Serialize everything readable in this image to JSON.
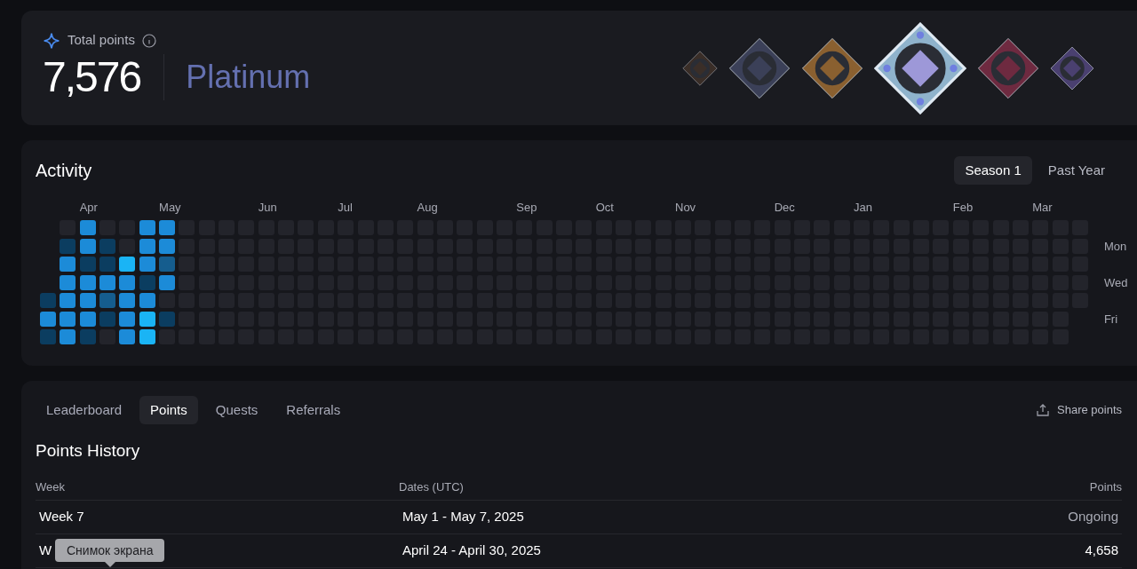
{
  "summary": {
    "label": "Total points",
    "total": "7,576",
    "tier": "Platinum"
  },
  "medals": [
    {
      "color": "#3a2e28",
      "selected": false
    },
    {
      "color": "#3b4058",
      "selected": false
    },
    {
      "color": "#8a6030",
      "selected": false
    },
    {
      "color": "#8fb3cc",
      "selected": true
    },
    {
      "color": "#6e2a40",
      "selected": false
    },
    {
      "color": "#4a4070",
      "selected": false
    }
  ],
  "activity": {
    "title": "Activity",
    "ranges": [
      {
        "label": "Season 1",
        "selected": true
      },
      {
        "label": "Past Year",
        "selected": false
      }
    ],
    "weekdays": [
      {
        "label": "Mon"
      },
      {
        "label": "Wed"
      },
      {
        "label": "Fri"
      }
    ],
    "weeks": [
      {
        "days": [
          {
            "kind": "low"
          },
          {
            "kind": "high"
          },
          {
            "kind": "low"
          }
        ]
      },
      {
        "days": [
          {
            "kind": "empty"
          },
          {
            "kind": "low"
          },
          {
            "kind": "high"
          },
          {
            "kind": "high"
          },
          {
            "kind": "high"
          },
          {
            "kind": "high"
          },
          {
            "kind": "high"
          }
        ]
      },
      {
        "month": "Apr",
        "days": [
          {
            "kind": "high"
          },
          {
            "kind": "high"
          },
          {
            "kind": "low"
          },
          {
            "kind": "high"
          },
          {
            "kind": "high"
          },
          {
            "kind": "high"
          },
          {
            "kind": "low"
          }
        ]
      },
      {
        "days": [
          {
            "kind": "empty"
          },
          {
            "kind": "low"
          },
          {
            "kind": "low"
          },
          {
            "kind": "high"
          },
          {
            "kind": "mid"
          },
          {
            "kind": "low"
          },
          {
            "kind": "empty"
          }
        ]
      },
      {
        "days": [
          {
            "kind": "empty"
          },
          {
            "kind": "empty"
          },
          {
            "kind": "max"
          },
          {
            "kind": "high"
          },
          {
            "kind": "high"
          },
          {
            "kind": "high"
          },
          {
            "kind": "high"
          }
        ]
      },
      {
        "days": [
          {
            "kind": "high"
          },
          {
            "kind": "high"
          },
          {
            "kind": "high"
          },
          {
            "kind": "low"
          },
          {
            "kind": "high"
          },
          {
            "kind": "max"
          },
          {
            "kind": "max"
          }
        ]
      },
      {
        "month": "May",
        "days": [
          {
            "kind": "high"
          },
          {
            "kind": "high"
          },
          {
            "kind": "mid"
          },
          {
            "kind": "high"
          },
          {
            "kind": "empty"
          },
          {
            "kind": "low"
          },
          {
            "kind": "empty"
          }
        ]
      },
      {
        "days": [
          {
            "kind": "empty"
          },
          {
            "kind": "empty"
          },
          {
            "kind": "empty"
          },
          {
            "kind": "empty"
          },
          {
            "kind": "empty"
          },
          {
            "kind": "empty"
          },
          {
            "kind": "empty"
          }
        ]
      },
      {
        "days": [
          {
            "kind": "empty"
          },
          {
            "kind": "empty"
          },
          {
            "kind": "empty"
          },
          {
            "kind": "empty"
          },
          {
            "kind": "empty"
          },
          {
            "kind": "empty"
          },
          {
            "kind": "empty"
          }
        ]
      },
      {
        "days": [
          {
            "kind": "empty"
          },
          {
            "kind": "empty"
          },
          {
            "kind": "empty"
          },
          {
            "kind": "empty"
          },
          {
            "kind": "empty"
          },
          {
            "kind": "empty"
          },
          {
            "kind": "empty"
          }
        ]
      },
      {
        "days": [
          {
            "kind": "empty"
          },
          {
            "kind": "empty"
          },
          {
            "kind": "empty"
          },
          {
            "kind": "empty"
          },
          {
            "kind": "empty"
          },
          {
            "kind": "empty"
          },
          {
            "kind": "empty"
          }
        ]
      },
      {
        "month": "Jun",
        "days": [
          {
            "kind": "empty"
          },
          {
            "kind": "empty"
          },
          {
            "kind": "empty"
          },
          {
            "kind": "empty"
          },
          {
            "kind": "empty"
          },
          {
            "kind": "empty"
          },
          {
            "kind": "empty"
          }
        ]
      },
      {
        "days": [
          {
            "kind": "empty"
          },
          {
            "kind": "empty"
          },
          {
            "kind": "empty"
          },
          {
            "kind": "empty"
          },
          {
            "kind": "empty"
          },
          {
            "kind": "empty"
          },
          {
            "kind": "empty"
          }
        ]
      },
      {
        "days": [
          {
            "kind": "empty"
          },
          {
            "kind": "empty"
          },
          {
            "kind": "empty"
          },
          {
            "kind": "empty"
          },
          {
            "kind": "empty"
          },
          {
            "kind": "empty"
          },
          {
            "kind": "empty"
          }
        ]
      },
      {
        "days": [
          {
            "kind": "empty"
          },
          {
            "kind": "empty"
          },
          {
            "kind": "empty"
          },
          {
            "kind": "empty"
          },
          {
            "kind": "empty"
          },
          {
            "kind": "empty"
          },
          {
            "kind": "empty"
          }
        ]
      },
      {
        "month": "Jul",
        "days": [
          {
            "kind": "empty"
          },
          {
            "kind": "empty"
          },
          {
            "kind": "empty"
          },
          {
            "kind": "empty"
          },
          {
            "kind": "empty"
          },
          {
            "kind": "empty"
          },
          {
            "kind": "empty"
          }
        ]
      },
      {
        "days": [
          {
            "kind": "empty"
          },
          {
            "kind": "empty"
          },
          {
            "kind": "empty"
          },
          {
            "kind": "empty"
          },
          {
            "kind": "empty"
          },
          {
            "kind": "empty"
          },
          {
            "kind": "empty"
          }
        ]
      },
      {
        "days": [
          {
            "kind": "empty"
          },
          {
            "kind": "empty"
          },
          {
            "kind": "empty"
          },
          {
            "kind": "empty"
          },
          {
            "kind": "empty"
          },
          {
            "kind": "empty"
          },
          {
            "kind": "empty"
          }
        ]
      },
      {
        "days": [
          {
            "kind": "empty"
          },
          {
            "kind": "empty"
          },
          {
            "kind": "empty"
          },
          {
            "kind": "empty"
          },
          {
            "kind": "empty"
          },
          {
            "kind": "empty"
          },
          {
            "kind": "empty"
          }
        ]
      },
      {
        "month": "Aug",
        "days": [
          {
            "kind": "empty"
          },
          {
            "kind": "empty"
          },
          {
            "kind": "empty"
          },
          {
            "kind": "empty"
          },
          {
            "kind": "empty"
          },
          {
            "kind": "empty"
          },
          {
            "kind": "empty"
          }
        ]
      },
      {
        "days": [
          {
            "kind": "empty"
          },
          {
            "kind": "empty"
          },
          {
            "kind": "empty"
          },
          {
            "kind": "empty"
          },
          {
            "kind": "empty"
          },
          {
            "kind": "empty"
          },
          {
            "kind": "empty"
          }
        ]
      },
      {
        "days": [
          {
            "kind": "empty"
          },
          {
            "kind": "empty"
          },
          {
            "kind": "empty"
          },
          {
            "kind": "empty"
          },
          {
            "kind": "empty"
          },
          {
            "kind": "empty"
          },
          {
            "kind": "empty"
          }
        ]
      },
      {
        "days": [
          {
            "kind": "empty"
          },
          {
            "kind": "empty"
          },
          {
            "kind": "empty"
          },
          {
            "kind": "empty"
          },
          {
            "kind": "empty"
          },
          {
            "kind": "empty"
          },
          {
            "kind": "empty"
          }
        ]
      },
      {
        "days": [
          {
            "kind": "empty"
          },
          {
            "kind": "empty"
          },
          {
            "kind": "empty"
          },
          {
            "kind": "empty"
          },
          {
            "kind": "empty"
          },
          {
            "kind": "empty"
          },
          {
            "kind": "empty"
          }
        ]
      },
      {
        "month": "Sep",
        "days": [
          {
            "kind": "empty"
          },
          {
            "kind": "empty"
          },
          {
            "kind": "empty"
          },
          {
            "kind": "empty"
          },
          {
            "kind": "empty"
          },
          {
            "kind": "empty"
          },
          {
            "kind": "empty"
          }
        ]
      },
      {
        "days": [
          {
            "kind": "empty"
          },
          {
            "kind": "empty"
          },
          {
            "kind": "empty"
          },
          {
            "kind": "empty"
          },
          {
            "kind": "empty"
          },
          {
            "kind": "empty"
          },
          {
            "kind": "empty"
          }
        ]
      },
      {
        "days": [
          {
            "kind": "empty"
          },
          {
            "kind": "empty"
          },
          {
            "kind": "empty"
          },
          {
            "kind": "empty"
          },
          {
            "kind": "empty"
          },
          {
            "kind": "empty"
          },
          {
            "kind": "empty"
          }
        ]
      },
      {
        "days": [
          {
            "kind": "empty"
          },
          {
            "kind": "empty"
          },
          {
            "kind": "empty"
          },
          {
            "kind": "empty"
          },
          {
            "kind": "empty"
          },
          {
            "kind": "empty"
          },
          {
            "kind": "empty"
          }
        ]
      },
      {
        "month": "Oct",
        "days": [
          {
            "kind": "empty"
          },
          {
            "kind": "empty"
          },
          {
            "kind": "empty"
          },
          {
            "kind": "empty"
          },
          {
            "kind": "empty"
          },
          {
            "kind": "empty"
          },
          {
            "kind": "empty"
          }
        ]
      },
      {
        "days": [
          {
            "kind": "empty"
          },
          {
            "kind": "empty"
          },
          {
            "kind": "empty"
          },
          {
            "kind": "empty"
          },
          {
            "kind": "empty"
          },
          {
            "kind": "empty"
          },
          {
            "kind": "empty"
          }
        ]
      },
      {
        "days": [
          {
            "kind": "empty"
          },
          {
            "kind": "empty"
          },
          {
            "kind": "empty"
          },
          {
            "kind": "empty"
          },
          {
            "kind": "empty"
          },
          {
            "kind": "empty"
          },
          {
            "kind": "empty"
          }
        ]
      },
      {
        "days": [
          {
            "kind": "empty"
          },
          {
            "kind": "empty"
          },
          {
            "kind": "empty"
          },
          {
            "kind": "empty"
          },
          {
            "kind": "empty"
          },
          {
            "kind": "empty"
          },
          {
            "kind": "empty"
          }
        ]
      },
      {
        "month": "Nov",
        "days": [
          {
            "kind": "empty"
          },
          {
            "kind": "empty"
          },
          {
            "kind": "empty"
          },
          {
            "kind": "empty"
          },
          {
            "kind": "empty"
          },
          {
            "kind": "empty"
          },
          {
            "kind": "empty"
          }
        ]
      },
      {
        "days": [
          {
            "kind": "empty"
          },
          {
            "kind": "empty"
          },
          {
            "kind": "empty"
          },
          {
            "kind": "empty"
          },
          {
            "kind": "empty"
          },
          {
            "kind": "empty"
          },
          {
            "kind": "empty"
          }
        ]
      },
      {
        "days": [
          {
            "kind": "empty"
          },
          {
            "kind": "empty"
          },
          {
            "kind": "empty"
          },
          {
            "kind": "empty"
          },
          {
            "kind": "empty"
          },
          {
            "kind": "empty"
          },
          {
            "kind": "empty"
          }
        ]
      },
      {
        "days": [
          {
            "kind": "empty"
          },
          {
            "kind": "empty"
          },
          {
            "kind": "empty"
          },
          {
            "kind": "empty"
          },
          {
            "kind": "empty"
          },
          {
            "kind": "empty"
          },
          {
            "kind": "empty"
          }
        ]
      },
      {
        "days": [
          {
            "kind": "empty"
          },
          {
            "kind": "empty"
          },
          {
            "kind": "empty"
          },
          {
            "kind": "empty"
          },
          {
            "kind": "empty"
          },
          {
            "kind": "empty"
          },
          {
            "kind": "empty"
          }
        ]
      },
      {
        "month": "Dec",
        "days": [
          {
            "kind": "empty"
          },
          {
            "kind": "empty"
          },
          {
            "kind": "empty"
          },
          {
            "kind": "empty"
          },
          {
            "kind": "empty"
          },
          {
            "kind": "empty"
          },
          {
            "kind": "empty"
          }
        ]
      },
      {
        "days": [
          {
            "kind": "empty"
          },
          {
            "kind": "empty"
          },
          {
            "kind": "empty"
          },
          {
            "kind": "empty"
          },
          {
            "kind": "empty"
          },
          {
            "kind": "empty"
          },
          {
            "kind": "empty"
          }
        ]
      },
      {
        "days": [
          {
            "kind": "empty"
          },
          {
            "kind": "empty"
          },
          {
            "kind": "empty"
          },
          {
            "kind": "empty"
          },
          {
            "kind": "empty"
          },
          {
            "kind": "empty"
          },
          {
            "kind": "empty"
          }
        ]
      },
      {
        "days": [
          {
            "kind": "empty"
          },
          {
            "kind": "empty"
          },
          {
            "kind": "empty"
          },
          {
            "kind": "empty"
          },
          {
            "kind": "empty"
          },
          {
            "kind": "empty"
          },
          {
            "kind": "empty"
          }
        ]
      },
      {
        "month": "Jan",
        "days": [
          {
            "kind": "empty"
          },
          {
            "kind": "empty"
          },
          {
            "kind": "empty"
          },
          {
            "kind": "empty"
          },
          {
            "kind": "empty"
          },
          {
            "kind": "empty"
          },
          {
            "kind": "empty"
          }
        ]
      },
      {
        "days": [
          {
            "kind": "empty"
          },
          {
            "kind": "empty"
          },
          {
            "kind": "empty"
          },
          {
            "kind": "empty"
          },
          {
            "kind": "empty"
          },
          {
            "kind": "empty"
          },
          {
            "kind": "empty"
          }
        ]
      },
      {
        "days": [
          {
            "kind": "empty"
          },
          {
            "kind": "empty"
          },
          {
            "kind": "empty"
          },
          {
            "kind": "empty"
          },
          {
            "kind": "empty"
          },
          {
            "kind": "empty"
          },
          {
            "kind": "empty"
          }
        ]
      },
      {
        "days": [
          {
            "kind": "empty"
          },
          {
            "kind": "empty"
          },
          {
            "kind": "empty"
          },
          {
            "kind": "empty"
          },
          {
            "kind": "empty"
          },
          {
            "kind": "empty"
          },
          {
            "kind": "empty"
          }
        ]
      },
      {
        "days": [
          {
            "kind": "empty"
          },
          {
            "kind": "empty"
          },
          {
            "kind": "empty"
          },
          {
            "kind": "empty"
          },
          {
            "kind": "empty"
          },
          {
            "kind": "empty"
          },
          {
            "kind": "empty"
          }
        ]
      },
      {
        "month": "Feb",
        "days": [
          {
            "kind": "empty"
          },
          {
            "kind": "empty"
          },
          {
            "kind": "empty"
          },
          {
            "kind": "empty"
          },
          {
            "kind": "empty"
          },
          {
            "kind": "empty"
          },
          {
            "kind": "empty"
          }
        ]
      },
      {
        "days": [
          {
            "kind": "empty"
          },
          {
            "kind": "empty"
          },
          {
            "kind": "empty"
          },
          {
            "kind": "empty"
          },
          {
            "kind": "empty"
          },
          {
            "kind": "empty"
          },
          {
            "kind": "empty"
          }
        ]
      },
      {
        "days": [
          {
            "kind": "empty"
          },
          {
            "kind": "empty"
          },
          {
            "kind": "empty"
          },
          {
            "kind": "empty"
          },
          {
            "kind": "empty"
          },
          {
            "kind": "empty"
          },
          {
            "kind": "empty"
          }
        ]
      },
      {
        "days": [
          {
            "kind": "empty"
          },
          {
            "kind": "empty"
          },
          {
            "kind": "empty"
          },
          {
            "kind": "empty"
          },
          {
            "kind": "empty"
          },
          {
            "kind": "empty"
          },
          {
            "kind": "empty"
          }
        ]
      },
      {
        "month": "Mar",
        "days": [
          {
            "kind": "empty"
          },
          {
            "kind": "empty"
          },
          {
            "kind": "empty"
          },
          {
            "kind": "empty"
          },
          {
            "kind": "empty"
          },
          {
            "kind": "empty"
          },
          {
            "kind": "empty"
          }
        ]
      },
      {
        "days": [
          {
            "kind": "empty"
          },
          {
            "kind": "empty"
          },
          {
            "kind": "empty"
          },
          {
            "kind": "empty"
          },
          {
            "kind": "empty"
          },
          {
            "kind": "empty"
          },
          {
            "kind": "empty"
          }
        ]
      },
      {
        "days": [
          {
            "kind": "empty"
          },
          {
            "kind": "empty"
          },
          {
            "kind": "empty"
          },
          {
            "kind": "empty"
          },
          {
            "kind": "empty"
          }
        ]
      }
    ]
  },
  "tabs": [
    {
      "label": "Leaderboard",
      "selected": false
    },
    {
      "label": "Points",
      "selected": true
    },
    {
      "label": "Quests",
      "selected": false
    },
    {
      "label": "Referrals",
      "selected": false
    }
  ],
  "share_button": "Share points",
  "history": {
    "title": "Points History",
    "columns": [
      "Week",
      "Dates (UTC)",
      "Points"
    ],
    "rows": [
      {
        "week": "Week 7",
        "dates": "May 1 - May 7, 2025",
        "points": "Ongoing",
        "kind": "ongoing"
      },
      {
        "week": "W",
        "dates": "April 24 - April 30, 2025",
        "points": "4,658",
        "kind": "final"
      }
    ]
  },
  "tooltip": "Снимок экрана"
}
